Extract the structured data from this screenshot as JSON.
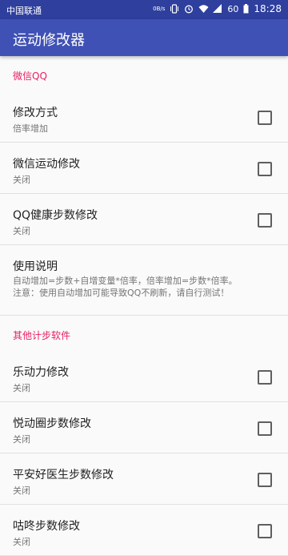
{
  "statusbar": {
    "carrier": "中国联通",
    "speed_top": "0B/s",
    "battery": "60",
    "time": "18:28"
  },
  "appbar": {
    "title": "运动修改器"
  },
  "sections": [
    {
      "header": "微信QQ",
      "items": [
        {
          "title": "修改方式",
          "summary": "倍率增加"
        },
        {
          "title": "微信运动修改",
          "summary": "关闭"
        },
        {
          "title": "QQ健康步数修改",
          "summary": "关闭"
        }
      ],
      "info": {
        "title": "使用说明",
        "line1": "自动增加=步数+自增变量*倍率，倍率增加=步数*倍率。",
        "line2": "注意：使用自动增加可能导致QQ不刷新，请自行测试！"
      }
    },
    {
      "header": "其他计步软件",
      "items": [
        {
          "title": "乐动力修改",
          "summary": "关闭"
        },
        {
          "title": "悦动圈步数修改",
          "summary": "关闭"
        },
        {
          "title": "平安好医生步数修改",
          "summary": "关闭"
        },
        {
          "title": "咕咚步数修改",
          "summary": "关闭"
        }
      ]
    }
  ],
  "colors": {
    "primary": "#3f51b5",
    "primary_dark": "#2e3f9e",
    "accent": "#e91e63"
  },
  "icons": [
    "vibrate-icon",
    "alarm-icon",
    "wifi-icon",
    "signal-icon",
    "battery-icon"
  ]
}
